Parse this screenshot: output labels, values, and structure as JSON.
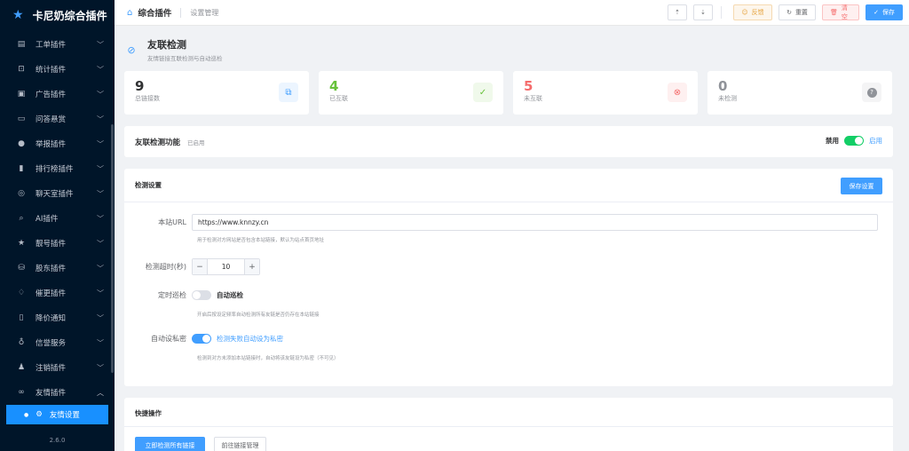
{
  "brand": {
    "name": "卡尼奶综合插件",
    "icon": "star-icon"
  },
  "sidebar": {
    "items": [
      {
        "label": "工单插件",
        "icon": "ticket-icon",
        "glyph": "▤"
      },
      {
        "label": "统计插件",
        "icon": "cart-icon",
        "glyph": "⊡"
      },
      {
        "label": "广告插件",
        "icon": "image-icon",
        "glyph": "▣"
      },
      {
        "label": "问答悬赏",
        "icon": "chat-icon",
        "glyph": "▭"
      },
      {
        "label": "举报插件",
        "icon": "warning-icon",
        "glyph": "●"
      },
      {
        "label": "排行榜插件",
        "icon": "bar-chart-icon",
        "glyph": "▮"
      },
      {
        "label": "聊天室插件",
        "icon": "chat-bubble-icon",
        "glyph": "◎"
      },
      {
        "label": "AI插件",
        "icon": "search-icon",
        "glyph": "⌕"
      },
      {
        "label": "靓号插件",
        "icon": "star-icon",
        "glyph": "★"
      },
      {
        "label": "股东插件",
        "icon": "coins-icon",
        "glyph": "⛁"
      },
      {
        "label": "催更插件",
        "icon": "bell-icon",
        "glyph": "♢"
      },
      {
        "label": "降价通知",
        "icon": "phone-icon",
        "glyph": "▯"
      },
      {
        "label": "信誉服务",
        "icon": "shield-icon",
        "glyph": "♁"
      },
      {
        "label": "注销插件",
        "icon": "user-icon",
        "glyph": "♟"
      },
      {
        "label": "友情插件",
        "icon": "link-icon",
        "glyph": "∞"
      }
    ],
    "active_sub": {
      "label": "友情设置",
      "icon": "settings-icon"
    },
    "version": "2.6.0"
  },
  "topbar": {
    "title": "综合插件",
    "subtitle": "设置管理",
    "buttons": {
      "import_glyph": "⇡",
      "export_glyph": "⇣",
      "feedback": "反馈",
      "reset": "重置",
      "clear": "清空",
      "save": "保存"
    }
  },
  "page": {
    "title": "友联检测",
    "subtitle": "友情链接互联检测与自动巡检"
  },
  "stats": [
    {
      "value": "9",
      "label": "总链接数",
      "icon": "copy-icon",
      "glyph": "⧉"
    },
    {
      "value": "4",
      "label": "已互联",
      "icon": "check-circle-icon",
      "glyph": "✓"
    },
    {
      "value": "5",
      "label": "未互联",
      "icon": "x-circle-icon",
      "glyph": "⊗"
    },
    {
      "value": "0",
      "label": "未检测",
      "icon": "question-icon",
      "glyph": "?"
    }
  ],
  "feature": {
    "title": "友联检测功能",
    "state": "已启用",
    "off_label": "禁用",
    "on_label": "启用",
    "enabled": true
  },
  "settings": {
    "title": "检测设置",
    "save_button": "保存设置",
    "url": {
      "label": "本站URL",
      "value": "https://www.knnzy.cn",
      "help": "用于检测对方网站是否包含本站链接，默认为站点首页地址"
    },
    "timeout": {
      "label": "检测超时(秒)",
      "value": "10",
      "minus": "−",
      "plus": "+"
    },
    "patrol": {
      "label": "定时巡检",
      "switch_label": "自动巡检",
      "enabled": false,
      "help": "开启后按设定频率自动检测所有友链是否仍存在本站链接"
    },
    "auto_private": {
      "label": "自动设私密",
      "switch_label": "检测失败自动设为私密",
      "enabled": true,
      "help": "检测到对方未添加本站链接时，自动将该友链设为私密（不可见）"
    }
  },
  "quick": {
    "title": "快捷操作",
    "check_all": "立即检测所有链接",
    "goto_manage": "前往链接管理"
  },
  "colors": {
    "primary": "#409eff",
    "sidebar_bg": "#001529",
    "success": "#67c23a",
    "danger": "#f56c6c",
    "warning": "#e6a23c",
    "switch_green": "#13ce66"
  }
}
